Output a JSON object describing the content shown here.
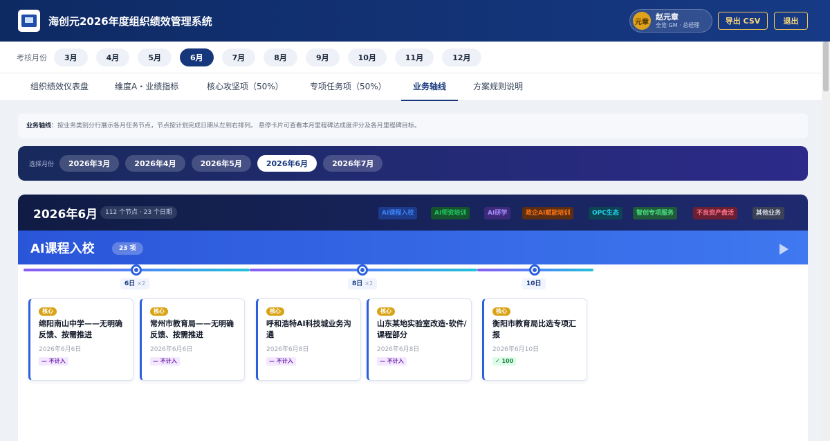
{
  "header": {
    "title": "海创元2026年度组织绩效管理系统",
    "user": {
      "avatar_text": "元章",
      "name": "赵元章",
      "role": "全览·GM · 总经理"
    },
    "export_label": "导出 CSV",
    "logout_label": "退出"
  },
  "month_nav": {
    "label": "考核月份",
    "months": [
      "3月",
      "4月",
      "5月",
      "6月",
      "7月",
      "8月",
      "9月",
      "10月",
      "11月",
      "12月"
    ],
    "active": "6月"
  },
  "tabs": [
    "组织绩效仪表盘",
    "维度A・业绩指标",
    "核心攻坚项（50%）",
    "专项任务项（50%）",
    "业务轴线",
    "方案规则说明"
  ],
  "active_tab": "业务轴线",
  "note": {
    "bold": "业务轴线",
    "text": "：按业务类别分行展示各月任务节点，节点按计划完成日期从左到右排列。 悬停卡片可查看本月里程碑达成度评分及各月里程碑目标。"
  },
  "month_selector": {
    "label": "选择月份",
    "months": [
      "2026年3月",
      "2026年4月",
      "2026年5月",
      "2026年6月",
      "2026年7月"
    ],
    "active": "2026年6月"
  },
  "panel": {
    "title": "2026年6月",
    "stats": "112 个节点 · 23 个日期",
    "legend": [
      {
        "label": "AI课程入校",
        "color": "#3b82f6",
        "bg": "#1e3a8a"
      },
      {
        "label": "AI师资培训",
        "color": "#22c55e",
        "bg": "#14532d"
      },
      {
        "label": "AI研学",
        "color": "#a78bfa",
        "bg": "#3b2a7a"
      },
      {
        "label": "政企AI赋能培训",
        "color": "#f97316",
        "bg": "#5b2e12"
      },
      {
        "label": "OPC生态",
        "color": "#22d3ee",
        "bg": "#0e4353"
      },
      {
        "label": "智创专项服务",
        "color": "#4ade80",
        "bg": "#1f5a3a"
      },
      {
        "label": "不良资产盘活",
        "color": "#fb7185",
        "bg": "#6b1f33"
      },
      {
        "label": "其他业务",
        "color": "#d1d5db",
        "bg": "#3b4258"
      }
    ],
    "category": {
      "title": "AI课程入校",
      "count": "23 项"
    },
    "timeline_dates": [
      {
        "day": "6日",
        "mult": "×2"
      },
      {
        "day": "8日",
        "mult": "×2"
      },
      {
        "day": "10日",
        "mult": ""
      }
    ],
    "cards": [
      {
        "tag": "核心",
        "title": "绵阳南山中学——无明确反馈、按需推进",
        "date": "2026年6月6日",
        "badge": "— 不计入",
        "status": "no"
      },
      {
        "tag": "核心",
        "title": "常州市教育局——无明确反馈、按需推进",
        "date": "2026年6月6日",
        "badge": "— 不计入",
        "status": "no"
      },
      {
        "tag": "核心",
        "title": "呼和浩特AI科技城业务沟通",
        "date": "2026年6月8日",
        "badge": "— 不计入",
        "status": "no"
      },
      {
        "tag": "核心",
        "title": "山东某地实验室改造-软件/课程部分",
        "date": "2026年6月8日",
        "badge": "— 不计入",
        "status": "no"
      },
      {
        "tag": "核心",
        "title": "衡阳市教育局比选专项汇报",
        "date": "2026年6月10日",
        "badge": "✓ 100",
        "status": "ok"
      }
    ]
  }
}
